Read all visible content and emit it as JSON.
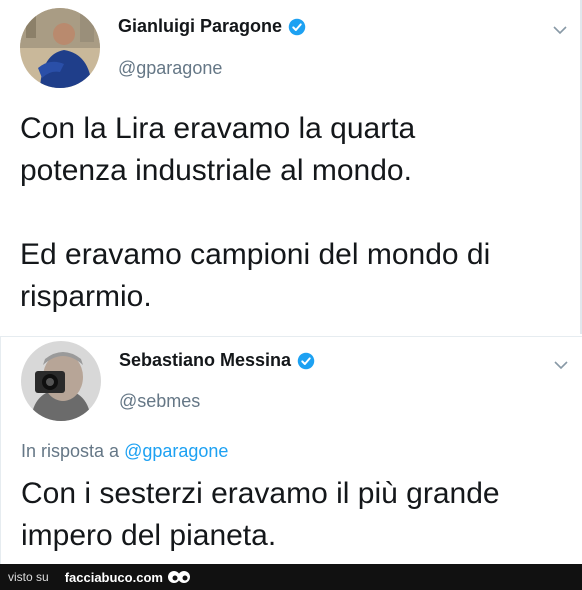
{
  "tweet1": {
    "name": "Gianluigi Paragone",
    "handle": "@gparagone",
    "text_line1": "Con la Lira eravamo la quarta",
    "text_line2": "potenza industriale al mondo.",
    "text_line3": "Ed eravamo campioni del mondo di",
    "text_line4": "risparmio."
  },
  "tweet2": {
    "name": "Sebastiano Messina",
    "handle": "@sebmes",
    "reply_prefix": "In risposta a ",
    "reply_mention": "@gparagone",
    "text_line1": "Con i sesterzi eravamo il più grande",
    "text_line2": "impero del pianeta."
  },
  "footer": {
    "visto": "visto su",
    "site": "facciabuco.com"
  },
  "colors": {
    "verified": "#1da1f2",
    "mention": "#1da1f2",
    "handle": "#657786"
  },
  "icons": [
    "verified-badge-icon",
    "chevron-down-icon",
    "facciabuco-eyes-logo"
  ]
}
